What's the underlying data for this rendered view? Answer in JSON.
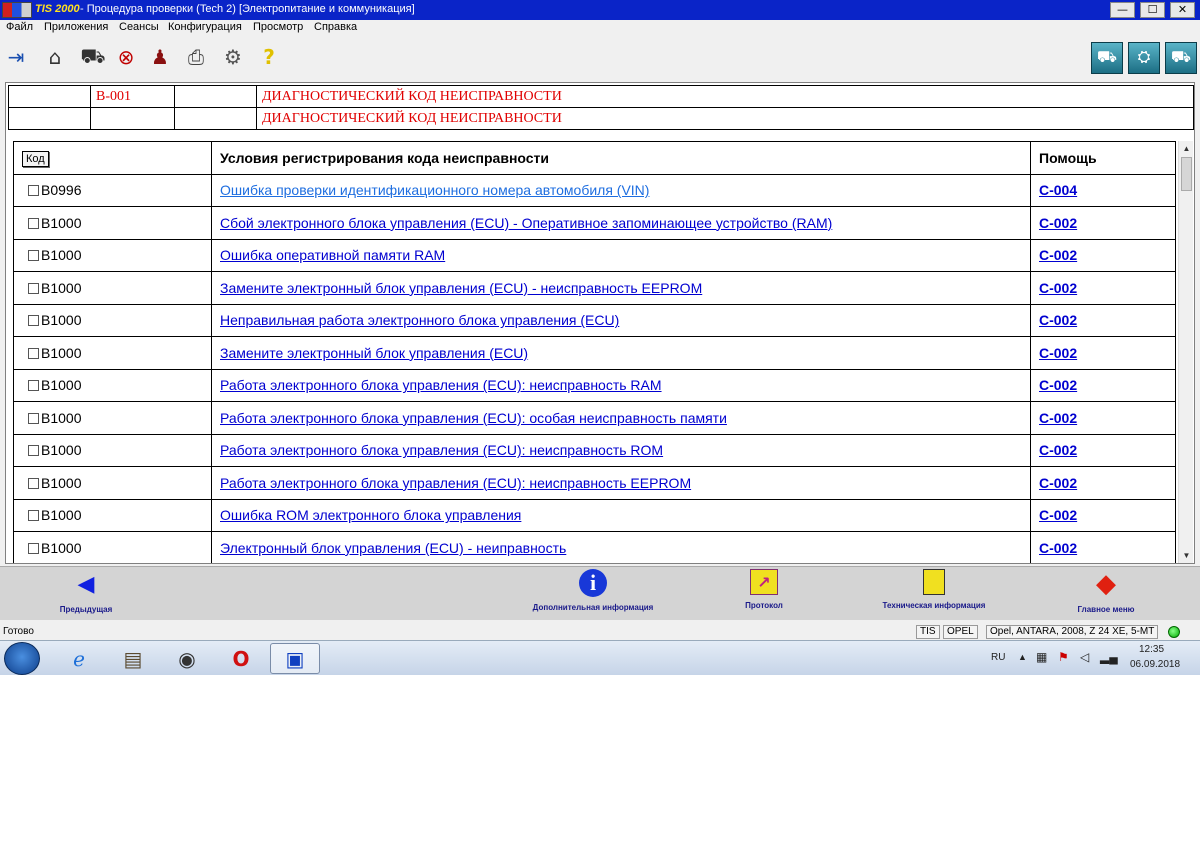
{
  "window": {
    "brand": "TIS 2000",
    "title": " - Процедура проверки (Tech 2) [Электропитание и коммуникация]",
    "minimize": "—",
    "maximize": "☐",
    "close": "✕"
  },
  "menu": [
    "Файл",
    "Приложения",
    "Сеансы",
    "Конфигурация",
    "Просмотр",
    "Справка"
  ],
  "toolbar": {
    "left_icons": [
      "exit-icon",
      "home-icon",
      "vehicle-icon",
      "stop-icon",
      "user-icon",
      "printer-icon",
      "settings-icon",
      "help-icon"
    ],
    "right_icons": [
      "tech2-icon",
      "diagnostic-icon",
      "vehicle-info-icon"
    ]
  },
  "header": {
    "code": "B-001",
    "line1": "ДИАГНОСТИЧЕСКИЙ КОД НЕИСПРАВНОСТИ",
    "line2": "ДИАГНОСТИЧЕСКИЙ КОД НЕИСПРАВНОСТИ"
  },
  "table": {
    "col_code": "Код",
    "col_condition": "Условия регистрирования кода неисправности",
    "col_help": "Помощь",
    "rows": [
      {
        "code": "B0996",
        "condition": "Ошибка проверки идентификационного номера автомобиля (VIN)",
        "help": "C-004"
      },
      {
        "code": "B1000",
        "condition": "Сбой электронного блока управления (ECU) - Оперативное запоминающее устройство (RAM)",
        "help": "C-002"
      },
      {
        "code": "B1000",
        "condition": "Ошибка оперативной памяти RAM",
        "help": "C-002"
      },
      {
        "code": "B1000",
        "condition": "Замените электронный блок управления (ECU) - неисправность EEPROM",
        "help": "C-002"
      },
      {
        "code": "B1000",
        "condition": "Неправильная работа электронного блока управления (ECU)",
        "help": "C-002"
      },
      {
        "code": "B1000",
        "condition": "Замените электронный блок управления (ECU)",
        "help": "C-002"
      },
      {
        "code": "B1000",
        "condition": "Работа электронного блока управления (ECU): неисправность RAM",
        "help": "C-002"
      },
      {
        "code": "B1000",
        "condition": "Работа электронного блока управления (ECU): особая неисправность памяти",
        "help": "C-002"
      },
      {
        "code": "B1000",
        "condition": "Работа электронного блока управления (ECU): неисправность ROM",
        "help": "C-002"
      },
      {
        "code": "B1000",
        "condition": "Работа электронного блока управления (ECU): неисправность EEPROM",
        "help": "C-002"
      },
      {
        "code": "B1000",
        "condition": "Ошибка ROM электронного блока управления",
        "help": "C-002"
      },
      {
        "code": "B1000",
        "condition": "Электронный блок управления (ECU) - неиправность",
        "help": "C-002"
      }
    ]
  },
  "nav": {
    "prev": "Предыдущая",
    "info": "Дополнительная информация",
    "protocol": "Протокол",
    "tech_info": "Техническая информация",
    "main_menu": "Главное меню"
  },
  "status": {
    "text": "Готово",
    "app": "TIS",
    "brand": "OPEL",
    "vehicle": "Opel, ANTARA, 2008, Z 24 XE, 5-MT"
  },
  "taskbar": {
    "lang": "RU",
    "time": "12:35",
    "date": "06.09.2018"
  }
}
